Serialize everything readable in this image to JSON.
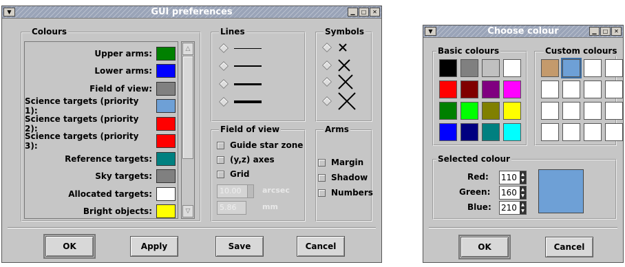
{
  "pref": {
    "title": "GUI preferences",
    "colours_label": "Colours",
    "colours": [
      {
        "label": "Upper arms:",
        "color": "#008000"
      },
      {
        "label": "Lower arms:",
        "color": "#0000ff"
      },
      {
        "label": "Field of view:",
        "color": "#808080"
      },
      {
        "label": "Science targets (priority 1):",
        "color": "#6ea0d6"
      },
      {
        "label": "Science targets (priority 2):",
        "color": "#ff0000"
      },
      {
        "label": "Science targets (priority 3):",
        "color": "#ff0000"
      },
      {
        "label": "Reference targets:",
        "color": "#008080"
      },
      {
        "label": "Sky targets:",
        "color": "#808080"
      },
      {
        "label": "Allocated targets:",
        "color": "#ffffff"
      },
      {
        "label": "Bright objects:",
        "color": "#ffff00"
      }
    ],
    "lines_label": "Lines",
    "symbols_label": "Symbols",
    "fov_label": "Field of view",
    "fov_options": [
      "Guide star zone",
      "(y,z) axes",
      "Grid"
    ],
    "arcsec_value": "10.00",
    "arcsec_unit": "arcsec",
    "mm_value": "5.86",
    "mm_unit": "mm",
    "arms_label": "Arms",
    "arms_options": [
      "Margin",
      "Shadow",
      "Numbers"
    ],
    "buttons": {
      "ok": "OK",
      "apply": "Apply",
      "save": "Save",
      "cancel": "Cancel"
    }
  },
  "choose": {
    "title": "Choose colour",
    "basic_label": "Basic colours",
    "custom_label": "Custom colours",
    "basic": [
      "#000000",
      "#808080",
      "#c0c0c0",
      "#ffffff",
      "#ff0000",
      "#800000",
      "#800080",
      "#ff00ff",
      "#008000",
      "#00ff00",
      "#808000",
      "#ffff00",
      "#0000ff",
      "#000080",
      "#008080",
      "#00ffff"
    ],
    "custom": [
      "#c49a6c",
      "#6ea0d6",
      "#ffffff",
      "#ffffff",
      "#ffffff",
      "#ffffff",
      "#ffffff",
      "#ffffff",
      "#ffffff",
      "#ffffff",
      "#ffffff",
      "#ffffff",
      "#ffffff",
      "#ffffff",
      "#ffffff",
      "#ffffff"
    ],
    "selected_label": "Selected colour",
    "red_label": "Red:",
    "red": "110",
    "green_label": "Green:",
    "green": "160",
    "blue_label": "Blue:",
    "blue": "210",
    "preview": "#6ea0d6",
    "buttons": {
      "ok": "OK",
      "cancel": "Cancel"
    }
  }
}
